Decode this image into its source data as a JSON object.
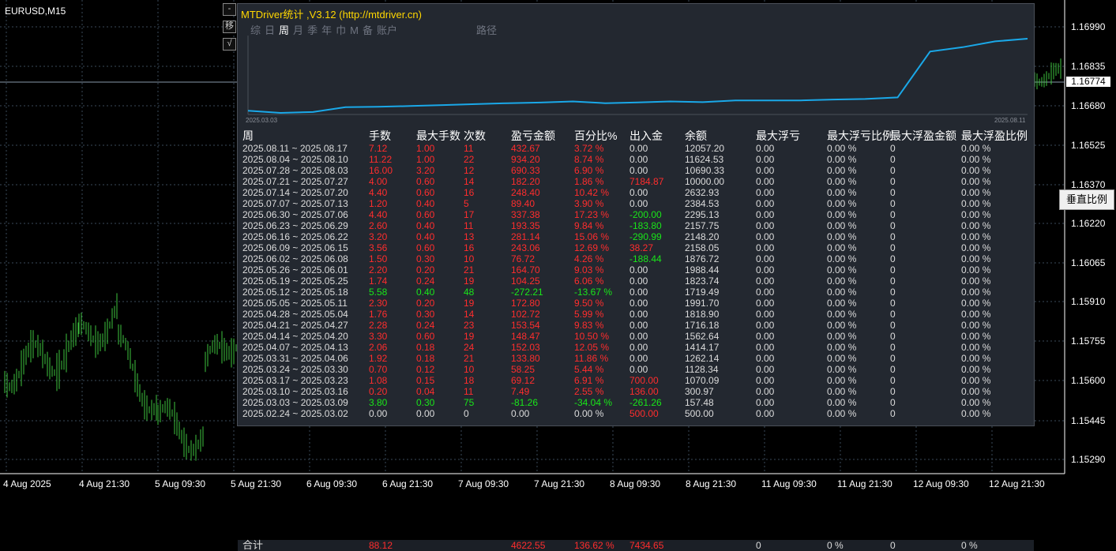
{
  "symbol": "EURUSD,M15",
  "price_axis": [
    "1.16990",
    "1.16835",
    "1.16680",
    "1.16525",
    "1.16370",
    "1.16220",
    "1.16065",
    "1.15910",
    "1.15755",
    "1.15600",
    "1.15445",
    "1.15290"
  ],
  "current_price": "1.16774",
  "vscale_label": "垂直比例",
  "time_axis": [
    "4 Aug 2025",
    "4 Aug 21:30",
    "5 Aug 09:30",
    "5 Aug 21:30",
    "6 Aug 09:30",
    "6 Aug 21:30",
    "7 Aug 09:30",
    "7 Aug 21:30",
    "8 Aug 09:30",
    "8 Aug 21:30",
    "11 Aug 09:30",
    "11 Aug 21:30",
    "12 Aug 09:30",
    "12 Aug 21:30"
  ],
  "side_buttons": [
    "-",
    "移",
    "√"
  ],
  "panel": {
    "title": "MTDriver统计 ,V3.12 (http://mtdriver.cn)",
    "tabs": [
      "综",
      "日",
      "周",
      "月",
      "季",
      "年",
      "巾",
      "M",
      "备",
      "账户"
    ],
    "active_tab": "周",
    "path_tab": "路径",
    "mini_chart": {
      "start_label": "2025.03.03",
      "end_label": "2025.08.11"
    },
    "headers": [
      "周",
      "手数",
      "最大手数",
      "次数",
      "盈亏金额",
      "百分比%",
      "出入金",
      "余额",
      "最大浮亏",
      "最大浮亏比例",
      "最大浮盈金额",
      "最大浮盈比例"
    ],
    "rows": [
      {
        "week": "2025.08.11 ~ 2025.08.17",
        "lots": "7.12",
        "maxlots": "1.00",
        "count": "11",
        "pl": "432.67",
        "pct": "3.72 %",
        "flow": "0.00",
        "bal": "12057.20",
        "mfl": "0.00",
        "mflp": "0.00 %",
        "mfp": "0",
        "mfpp": "0.00 %"
      },
      {
        "week": "2025.08.04 ~ 2025.08.10",
        "lots": "11.22",
        "maxlots": "1.00",
        "count": "22",
        "pl": "934.20",
        "pct": "8.74 %",
        "flow": "0.00",
        "bal": "11624.53",
        "mfl": "0.00",
        "mflp": "0.00 %",
        "mfp": "0",
        "mfpp": "0.00 %"
      },
      {
        "week": "2025.07.28 ~ 2025.08.03",
        "lots": "16.00",
        "maxlots": "3.20",
        "count": "12",
        "pl": "690.33",
        "pct": "6.90 %",
        "flow": "0.00",
        "bal": "10690.33",
        "mfl": "0.00",
        "mflp": "0.00 %",
        "mfp": "0",
        "mfpp": "0.00 %"
      },
      {
        "week": "2025.07.21 ~ 2025.07.27",
        "lots": "4.00",
        "maxlots": "0.60",
        "count": "14",
        "pl": "182.20",
        "pct": "1.86 %",
        "flow": "7184.87",
        "bal": "10000.00",
        "mfl": "0.00",
        "mflp": "0.00 %",
        "mfp": "0",
        "mfpp": "0.00 %"
      },
      {
        "week": "2025.07.14 ~ 2025.07.20",
        "lots": "4.40",
        "maxlots": "0.60",
        "count": "16",
        "pl": "248.40",
        "pct": "10.42 %",
        "flow": "0.00",
        "bal": "2632.93",
        "mfl": "0.00",
        "mflp": "0.00 %",
        "mfp": "0",
        "mfpp": "0.00 %"
      },
      {
        "week": "2025.07.07 ~ 2025.07.13",
        "lots": "1.20",
        "maxlots": "0.40",
        "count": "5",
        "pl": "89.40",
        "pct": "3.90 %",
        "flow": "0.00",
        "bal": "2384.53",
        "mfl": "0.00",
        "mflp": "0.00 %",
        "mfp": "0",
        "mfpp": "0.00 %"
      },
      {
        "week": "2025.06.30 ~ 2025.07.06",
        "lots": "4.40",
        "maxlots": "0.60",
        "count": "17",
        "pl": "337.38",
        "pct": "17.23 %",
        "flow": "-200.00",
        "bal": "2295.13",
        "mfl": "0.00",
        "mflp": "0.00 %",
        "mfp": "0",
        "mfpp": "0.00 %"
      },
      {
        "week": "2025.06.23 ~ 2025.06.29",
        "lots": "2.60",
        "maxlots": "0.40",
        "count": "11",
        "pl": "193.35",
        "pct": "9.84 %",
        "flow": "-183.80",
        "bal": "2157.75",
        "mfl": "0.00",
        "mflp": "0.00 %",
        "mfp": "0",
        "mfpp": "0.00 %"
      },
      {
        "week": "2025.06.16 ~ 2025.06.22",
        "lots": "3.20",
        "maxlots": "0.40",
        "count": "13",
        "pl": "281.14",
        "pct": "15.06 %",
        "flow": "-290.99",
        "bal": "2148.20",
        "mfl": "0.00",
        "mflp": "0.00 %",
        "mfp": "0",
        "mfpp": "0.00 %"
      },
      {
        "week": "2025.06.09 ~ 2025.06.15",
        "lots": "3.56",
        "maxlots": "0.60",
        "count": "16",
        "pl": "243.06",
        "pct": "12.69 %",
        "flow": "38.27",
        "bal": "2158.05",
        "mfl": "0.00",
        "mflp": "0.00 %",
        "mfp": "0",
        "mfpp": "0.00 %"
      },
      {
        "week": "2025.06.02 ~ 2025.06.08",
        "lots": "1.50",
        "maxlots": "0.30",
        "count": "10",
        "pl": "76.72",
        "pct": "4.26 %",
        "flow": "-188.44",
        "bal": "1876.72",
        "mfl": "0.00",
        "mflp": "0.00 %",
        "mfp": "0",
        "mfpp": "0.00 %"
      },
      {
        "week": "2025.05.26 ~ 2025.06.01",
        "lots": "2.20",
        "maxlots": "0.20",
        "count": "21",
        "pl": "164.70",
        "pct": "9.03 %",
        "flow": "0.00",
        "bal": "1988.44",
        "mfl": "0.00",
        "mflp": "0.00 %",
        "mfp": "0",
        "mfpp": "0.00 %"
      },
      {
        "week": "2025.05.19 ~ 2025.05.25",
        "lots": "1.74",
        "maxlots": "0.24",
        "count": "19",
        "pl": "104.25",
        "pct": "6.06 %",
        "flow": "0.00",
        "bal": "1823.74",
        "mfl": "0.00",
        "mflp": "0.00 %",
        "mfp": "0",
        "mfpp": "0.00 %"
      },
      {
        "week": "2025.05.12 ~ 2025.05.18",
        "lots": "5.58",
        "maxlots": "0.40",
        "count": "48",
        "pl": "-272.21",
        "pct": "-13.67 %",
        "flow": "0.00",
        "bal": "1719.49",
        "mfl": "0.00",
        "mflp": "0.00 %",
        "mfp": "0",
        "mfpp": "0.00 %"
      },
      {
        "week": "2025.05.05 ~ 2025.05.11",
        "lots": "2.30",
        "maxlots": "0.20",
        "count": "19",
        "pl": "172.80",
        "pct": "9.50 %",
        "flow": "0.00",
        "bal": "1991.70",
        "mfl": "0.00",
        "mflp": "0.00 %",
        "mfp": "0",
        "mfpp": "0.00 %"
      },
      {
        "week": "2025.04.28 ~ 2025.05.04",
        "lots": "1.76",
        "maxlots": "0.30",
        "count": "14",
        "pl": "102.72",
        "pct": "5.99 %",
        "flow": "0.00",
        "bal": "1818.90",
        "mfl": "0.00",
        "mflp": "0.00 %",
        "mfp": "0",
        "mfpp": "0.00 %"
      },
      {
        "week": "2025.04.21 ~ 2025.04.27",
        "lots": "2.28",
        "maxlots": "0.24",
        "count": "23",
        "pl": "153.54",
        "pct": "9.83 %",
        "flow": "0.00",
        "bal": "1716.18",
        "mfl": "0.00",
        "mflp": "0.00 %",
        "mfp": "0",
        "mfpp": "0.00 %"
      },
      {
        "week": "2025.04.14 ~ 2025.04.20",
        "lots": "3.30",
        "maxlots": "0.60",
        "count": "19",
        "pl": "148.47",
        "pct": "10.50 %",
        "flow": "0.00",
        "bal": "1562.64",
        "mfl": "0.00",
        "mflp": "0.00 %",
        "mfp": "0",
        "mfpp": "0.00 %"
      },
      {
        "week": "2025.04.07 ~ 2025.04.13",
        "lots": "2.06",
        "maxlots": "0.18",
        "count": "24",
        "pl": "152.03",
        "pct": "12.05 %",
        "flow": "0.00",
        "bal": "1414.17",
        "mfl": "0.00",
        "mflp": "0.00 %",
        "mfp": "0",
        "mfpp": "0.00 %"
      },
      {
        "week": "2025.03.31 ~ 2025.04.06",
        "lots": "1.92",
        "maxlots": "0.18",
        "count": "21",
        "pl": "133.80",
        "pct": "11.86 %",
        "flow": "0.00",
        "bal": "1262.14",
        "mfl": "0.00",
        "mflp": "0.00 %",
        "mfp": "0",
        "mfpp": "0.00 %"
      },
      {
        "week": "2025.03.24 ~ 2025.03.30",
        "lots": "0.70",
        "maxlots": "0.12",
        "count": "10",
        "pl": "58.25",
        "pct": "5.44 %",
        "flow": "0.00",
        "bal": "1128.34",
        "mfl": "0.00",
        "mflp": "0.00 %",
        "mfp": "0",
        "mfpp": "0.00 %"
      },
      {
        "week": "2025.03.17 ~ 2025.03.23",
        "lots": "1.08",
        "maxlots": "0.15",
        "count": "18",
        "pl": "69.12",
        "pct": "6.91 %",
        "flow": "700.00",
        "bal": "1070.09",
        "mfl": "0.00",
        "mflp": "0.00 %",
        "mfp": "0",
        "mfpp": "0.00 %"
      },
      {
        "week": "2025.03.10 ~ 2025.03.16",
        "lots": "0.20",
        "maxlots": "0.04",
        "count": "11",
        "pl": "7.49",
        "pct": "2.55 %",
        "flow": "136.00",
        "bal": "300.97",
        "mfl": "0.00",
        "mflp": "0.00 %",
        "mfp": "0",
        "mfpp": "0.00 %"
      },
      {
        "week": "2025.03.03 ~ 2025.03.09",
        "lots": "3.80",
        "maxlots": "0.30",
        "count": "75",
        "pl": "-81.26",
        "pct": "-34.04 %",
        "flow": "-261.26",
        "bal": "157.48",
        "mfl": "0.00",
        "mflp": "0.00 %",
        "mfp": "0",
        "mfpp": "0.00 %"
      },
      {
        "week": "2025.02.24 ~ 2025.03.02",
        "lots": "0.00",
        "maxlots": "0.00",
        "count": "0",
        "pl": "0.00",
        "pct": "0.00 %",
        "flow": "500.00",
        "bal": "500.00",
        "mfl": "0.00",
        "mflp": "0.00 %",
        "mfp": "0",
        "mfpp": "0.00 %"
      }
    ],
    "total": {
      "label": "合计",
      "lots": "88.12",
      "pl": "4622.55",
      "pct": "136.62 %",
      "flow": "7434.65",
      "mfl": "0",
      "mflp": "0 %",
      "mfp": "0",
      "mfpp": "0 %"
    }
  },
  "colors": {
    "bg": "#000000",
    "candles": "#3ec43e",
    "grid": "#3a4a5a",
    "panel": "#232830",
    "equity_line": "#1aa8e8",
    "positive": "#ff2d2d",
    "negative": "#19e619",
    "title": "#ffd700"
  }
}
